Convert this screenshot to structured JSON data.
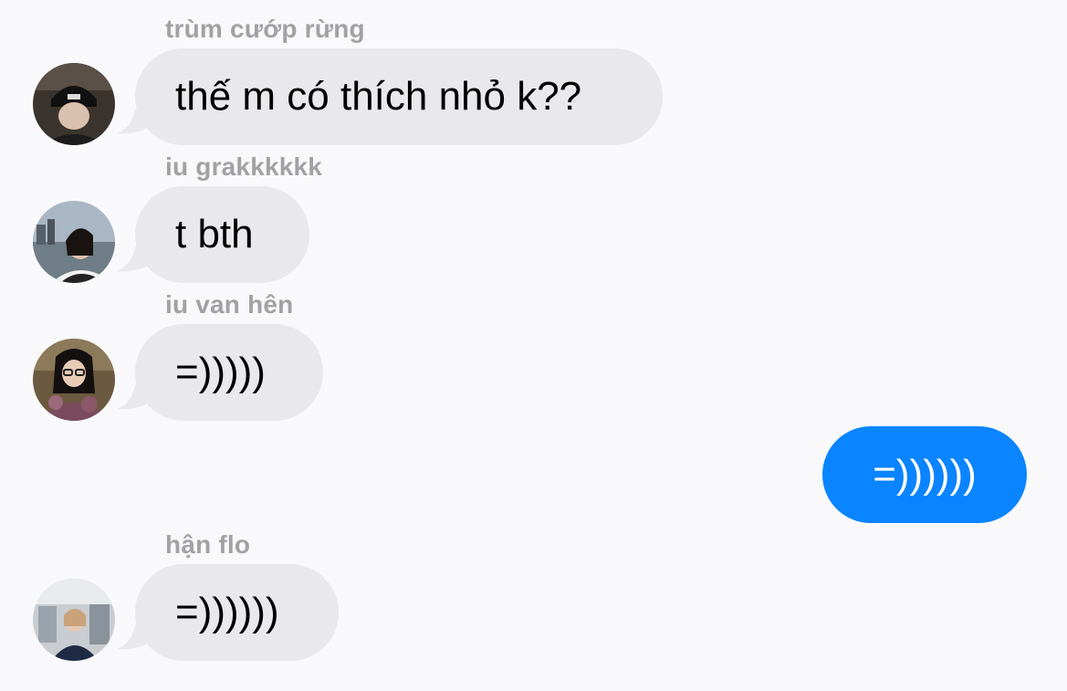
{
  "messages": [
    {
      "sender": "trùm cướp rừng",
      "text": "thế m có thích nhỏ k??"
    },
    {
      "sender": "iu grakkkkkk",
      "text": "t bth"
    },
    {
      "sender": "iu van hên",
      "text": "=)))))"
    },
    {
      "sender": "",
      "text": "=))))))"
    },
    {
      "sender": "hận flo",
      "text": "=))))))"
    }
  ],
  "colors": {
    "background": "#f9f9fb",
    "incoming_bubble": "#e9e9eb",
    "outgoing_bubble": "#0a84ff",
    "sender_name": "#a1a1a6"
  },
  "icons": [
    "avatar-trum-cuop-rung",
    "avatar-iu-grakkkkkk",
    "avatar-iu-van-hen",
    "avatar-han-flo"
  ]
}
